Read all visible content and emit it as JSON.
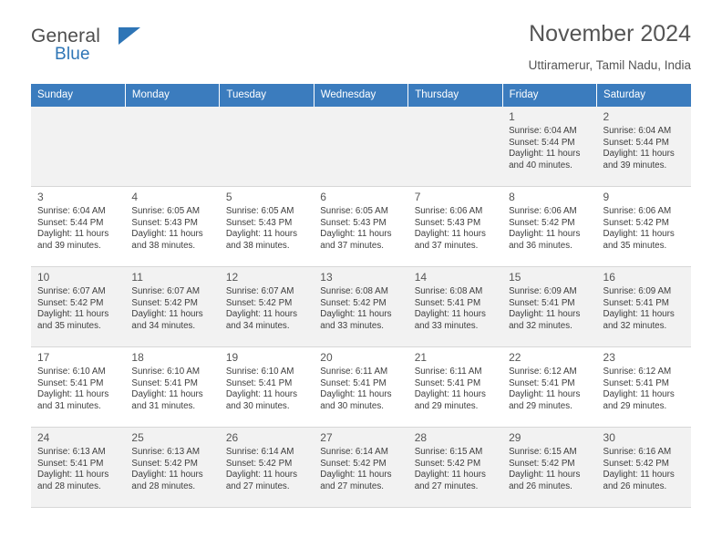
{
  "brand": {
    "name_part1": "General",
    "name_part2": "Blue"
  },
  "header": {
    "title": "November 2024",
    "location": "Uttiramerur, Tamil Nadu, India"
  },
  "calendar": {
    "weekdays": [
      "Sunday",
      "Monday",
      "Tuesday",
      "Wednesday",
      "Thursday",
      "Friday",
      "Saturday"
    ],
    "weeks": [
      [
        {
          "day": "",
          "info": ""
        },
        {
          "day": "",
          "info": ""
        },
        {
          "day": "",
          "info": ""
        },
        {
          "day": "",
          "info": ""
        },
        {
          "day": "",
          "info": ""
        },
        {
          "day": "1",
          "info": "Sunrise: 6:04 AM\nSunset: 5:44 PM\nDaylight: 11 hours\nand 40 minutes."
        },
        {
          "day": "2",
          "info": "Sunrise: 6:04 AM\nSunset: 5:44 PM\nDaylight: 11 hours\nand 39 minutes."
        }
      ],
      [
        {
          "day": "3",
          "info": "Sunrise: 6:04 AM\nSunset: 5:44 PM\nDaylight: 11 hours\nand 39 minutes."
        },
        {
          "day": "4",
          "info": "Sunrise: 6:05 AM\nSunset: 5:43 PM\nDaylight: 11 hours\nand 38 minutes."
        },
        {
          "day": "5",
          "info": "Sunrise: 6:05 AM\nSunset: 5:43 PM\nDaylight: 11 hours\nand 38 minutes."
        },
        {
          "day": "6",
          "info": "Sunrise: 6:05 AM\nSunset: 5:43 PM\nDaylight: 11 hours\nand 37 minutes."
        },
        {
          "day": "7",
          "info": "Sunrise: 6:06 AM\nSunset: 5:43 PM\nDaylight: 11 hours\nand 37 minutes."
        },
        {
          "day": "8",
          "info": "Sunrise: 6:06 AM\nSunset: 5:42 PM\nDaylight: 11 hours\nand 36 minutes."
        },
        {
          "day": "9",
          "info": "Sunrise: 6:06 AM\nSunset: 5:42 PM\nDaylight: 11 hours\nand 35 minutes."
        }
      ],
      [
        {
          "day": "10",
          "info": "Sunrise: 6:07 AM\nSunset: 5:42 PM\nDaylight: 11 hours\nand 35 minutes."
        },
        {
          "day": "11",
          "info": "Sunrise: 6:07 AM\nSunset: 5:42 PM\nDaylight: 11 hours\nand 34 minutes."
        },
        {
          "day": "12",
          "info": "Sunrise: 6:07 AM\nSunset: 5:42 PM\nDaylight: 11 hours\nand 34 minutes."
        },
        {
          "day": "13",
          "info": "Sunrise: 6:08 AM\nSunset: 5:42 PM\nDaylight: 11 hours\nand 33 minutes."
        },
        {
          "day": "14",
          "info": "Sunrise: 6:08 AM\nSunset: 5:41 PM\nDaylight: 11 hours\nand 33 minutes."
        },
        {
          "day": "15",
          "info": "Sunrise: 6:09 AM\nSunset: 5:41 PM\nDaylight: 11 hours\nand 32 minutes."
        },
        {
          "day": "16",
          "info": "Sunrise: 6:09 AM\nSunset: 5:41 PM\nDaylight: 11 hours\nand 32 minutes."
        }
      ],
      [
        {
          "day": "17",
          "info": "Sunrise: 6:10 AM\nSunset: 5:41 PM\nDaylight: 11 hours\nand 31 minutes."
        },
        {
          "day": "18",
          "info": "Sunrise: 6:10 AM\nSunset: 5:41 PM\nDaylight: 11 hours\nand 31 minutes."
        },
        {
          "day": "19",
          "info": "Sunrise: 6:10 AM\nSunset: 5:41 PM\nDaylight: 11 hours\nand 30 minutes."
        },
        {
          "day": "20",
          "info": "Sunrise: 6:11 AM\nSunset: 5:41 PM\nDaylight: 11 hours\nand 30 minutes."
        },
        {
          "day": "21",
          "info": "Sunrise: 6:11 AM\nSunset: 5:41 PM\nDaylight: 11 hours\nand 29 minutes."
        },
        {
          "day": "22",
          "info": "Sunrise: 6:12 AM\nSunset: 5:41 PM\nDaylight: 11 hours\nand 29 minutes."
        },
        {
          "day": "23",
          "info": "Sunrise: 6:12 AM\nSunset: 5:41 PM\nDaylight: 11 hours\nand 29 minutes."
        }
      ],
      [
        {
          "day": "24",
          "info": "Sunrise: 6:13 AM\nSunset: 5:41 PM\nDaylight: 11 hours\nand 28 minutes."
        },
        {
          "day": "25",
          "info": "Sunrise: 6:13 AM\nSunset: 5:42 PM\nDaylight: 11 hours\nand 28 minutes."
        },
        {
          "day": "26",
          "info": "Sunrise: 6:14 AM\nSunset: 5:42 PM\nDaylight: 11 hours\nand 27 minutes."
        },
        {
          "day": "27",
          "info": "Sunrise: 6:14 AM\nSunset: 5:42 PM\nDaylight: 11 hours\nand 27 minutes."
        },
        {
          "day": "28",
          "info": "Sunrise: 6:15 AM\nSunset: 5:42 PM\nDaylight: 11 hours\nand 27 minutes."
        },
        {
          "day": "29",
          "info": "Sunrise: 6:15 AM\nSunset: 5:42 PM\nDaylight: 11 hours\nand 26 minutes."
        },
        {
          "day": "30",
          "info": "Sunrise: 6:16 AM\nSunset: 5:42 PM\nDaylight: 11 hours\nand 26 minutes."
        }
      ]
    ]
  },
  "colors": {
    "header_blue": "#3b7cbe",
    "brand_blue": "#2e75b6",
    "shade_row": "#f2f2f2"
  }
}
